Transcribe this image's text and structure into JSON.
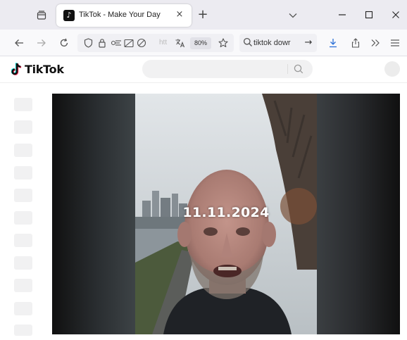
{
  "browser": {
    "tab": {
      "title": "TikTok - Make Your Day",
      "close_glyph": "×"
    },
    "new_tab_glyph": "+",
    "url_text": "htt",
    "zoom": "80%",
    "search": {
      "query": "tiktok dowr",
      "go_glyph": "→"
    }
  },
  "tiktok": {
    "logo_text": "TikTok",
    "search_placeholder": ""
  },
  "video": {
    "date_overlay": "11.11.2024"
  },
  "colors": {
    "tabstrip_bg": "#ecebf1",
    "navbar_bg": "#f9f9fb",
    "tiktok_cyan": "#25f4ee",
    "tiktok_red": "#fe2c55"
  }
}
